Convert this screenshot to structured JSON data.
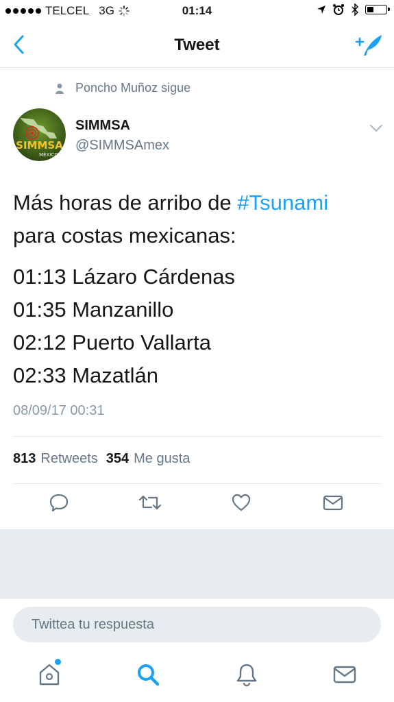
{
  "status_bar": {
    "carrier": "TELCEL",
    "network": "3G",
    "time": "01:14"
  },
  "nav": {
    "title": "Tweet"
  },
  "tweet": {
    "social_context": "Poncho Muñoz sigue",
    "author_name": "SIMMSA",
    "author_handle": "@SIMMSAmex",
    "avatar_text": "SIMMSA",
    "avatar_subtext": "MÉXICO",
    "text_line1_prefix": "Más horas de arribo de ",
    "text_hashtag": "#Tsunami",
    "text_line2": "para costas mexicanas:",
    "arrivals": [
      "01:13 Lázaro Cárdenas",
      "01:35 Manzanillo",
      "02:12 Puerto Vallarta",
      "02:33 Mazatlán"
    ],
    "timestamp": "08/09/17 00:31",
    "retweets_count": "813",
    "retweets_label": "Retweets",
    "likes_count": "354",
    "likes_label": "Me gusta"
  },
  "reply": {
    "placeholder": "Twittea tu respuesta"
  },
  "colors": {
    "accent": "#1da1f2",
    "muted": "#657786",
    "separator": "#e1e8ed"
  },
  "icons": {
    "back": "chevron-left-icon",
    "compose": "compose-tweet-icon",
    "reply": "reply-icon",
    "retweet": "retweet-icon",
    "like": "heart-icon",
    "message": "envelope-icon",
    "home": "home-icon",
    "search": "search-icon",
    "notifications": "bell-icon"
  }
}
